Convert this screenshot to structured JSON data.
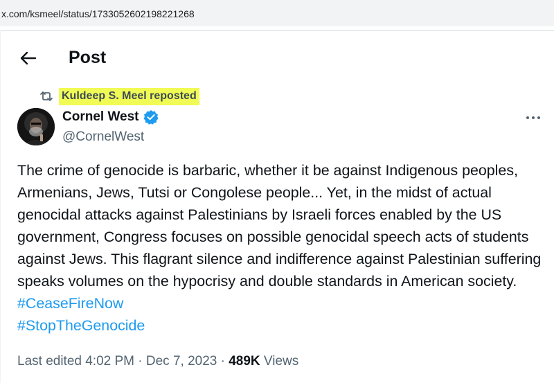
{
  "browser": {
    "url": "x.com/ksmeel/status/1733052602198221268"
  },
  "header": {
    "title": "Post"
  },
  "repost": {
    "label": "Kuldeep S. Meel reposted"
  },
  "author": {
    "name": "Cornel West",
    "handle": "@CornelWest",
    "verified": true
  },
  "tweet": {
    "text": "The crime of genocide is barbaric, whether it be against Indigenous peoples, Armenians, Jews, Tutsi or Congolese people... Yet, in the midst of actual genocidal attacks against Palestinians by Israeli forces enabled by the US government, Congress focuses on possible genocidal speech acts of students against Jews. This flagrant silence and indifference against Palestinian suffering speaks volumes on the hypocrisy and double standards in American society.",
    "hashtags": [
      "#CeaseFireNow",
      "#StopTheGenocide"
    ]
  },
  "meta": {
    "edited_label": "Last edited 4:02 PM · Dec 7, 2023 · ",
    "views_count": "489K",
    "views_label": " Views"
  },
  "colors": {
    "link": "#1d9bf0",
    "highlight": "#f1fb55",
    "secondary_text": "#536471",
    "verified_badge": "#1d9bf0"
  },
  "icons": {
    "back": "arrow-left-icon",
    "repost": "repost-icon",
    "verified": "verified-badge-icon",
    "more": "more-horizontal-icon"
  }
}
